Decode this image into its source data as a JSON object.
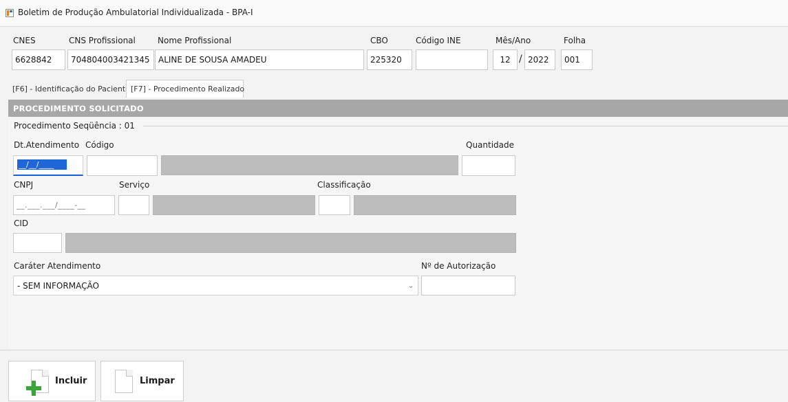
{
  "window": {
    "title": "Boletim de Produção Ambulatorial Individualizada - BPA-I"
  },
  "header": {
    "cnes": {
      "label": "CNES",
      "value": "6628842"
    },
    "cns_profissional": {
      "label": "CNS Profissional",
      "value": "704804003421345"
    },
    "nome_profissional": {
      "label": "Nome Profissional",
      "value": "ALINE DE SOUSA AMADEU"
    },
    "cbo": {
      "label": "CBO",
      "value": "225320"
    },
    "codigo_ine": {
      "label": "Código INE",
      "value": ""
    },
    "mes_ano": {
      "label": "Mês/Ano",
      "mes": "12",
      "sep": "/",
      "ano": "2022"
    },
    "folha": {
      "label": "Folha",
      "value": "001"
    }
  },
  "tabs": [
    {
      "label": "[F6] - Identificação do Paciente",
      "active": false
    },
    {
      "label": "[F7] - Procedimento Realizado",
      "active": true
    }
  ],
  "section": {
    "title": "PROCEDIMENTO SOLICITADO",
    "group_label": "Procedimento Seqüência : 01"
  },
  "form": {
    "dt_atendimento": {
      "label": "Dt.Atendimento",
      "mask": "__/__/____"
    },
    "codigo": {
      "label": "Código",
      "value": ""
    },
    "quantidade": {
      "label": "Quantidade",
      "value": ""
    },
    "cnpj": {
      "label": "CNPJ",
      "mask": "__.___.___/____-__"
    },
    "servico": {
      "label": "Serviço",
      "value": ""
    },
    "classificacao": {
      "label": "Classificação",
      "value": ""
    },
    "cid": {
      "label": "CID",
      "value": ""
    },
    "carater_atendimento": {
      "label": "Caráter Atendimento",
      "selected": "- SEM INFORMAÇÃO"
    },
    "num_autorizacao": {
      "label": "Nº de Autorização",
      "value": ""
    }
  },
  "buttons": {
    "incluir": "Incluir",
    "limpar": "Limpar"
  },
  "colors": {
    "accent": "#1f66d9",
    "section_header": "#a7a7a7",
    "disabled_field": "#bdbdbd",
    "plus_icon": "#3aa63a"
  },
  "icons": [
    "app-icon",
    "chevron-down-icon",
    "document-add-icon",
    "document-icon"
  ]
}
